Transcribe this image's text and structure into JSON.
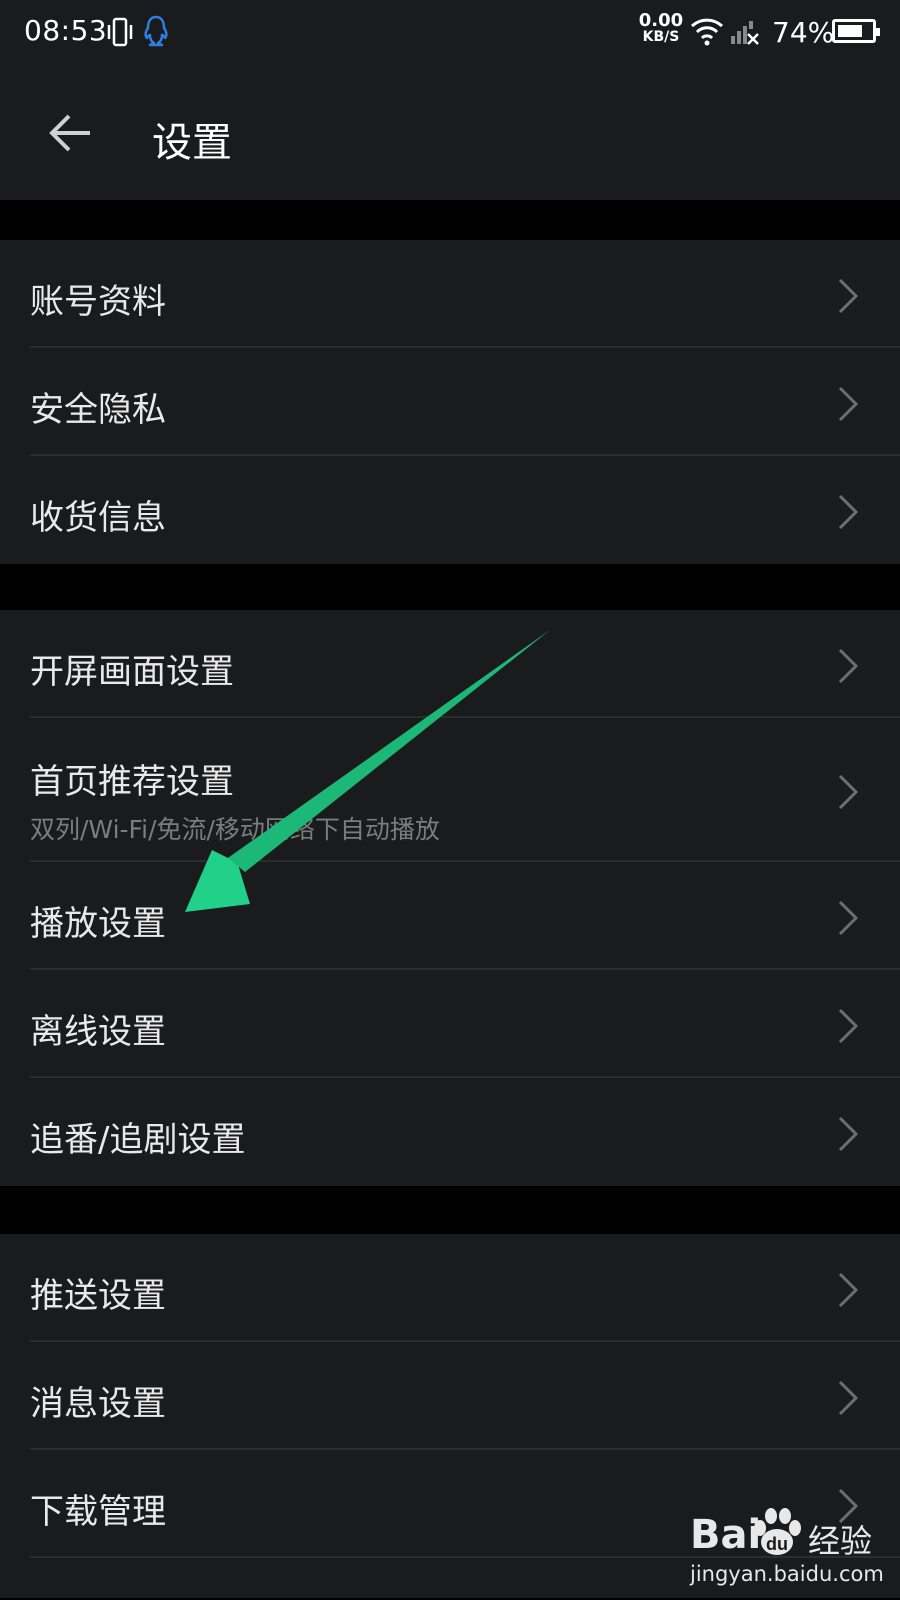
{
  "status_bar": {
    "time": "08:53",
    "speed_value": "0.00",
    "speed_unit": "KB/S",
    "battery_percent": "74%",
    "battery_level": 0.74,
    "icons": [
      "vibrate-icon",
      "qq-icon",
      "wifi-icon",
      "no-signal-icon",
      "battery-icon"
    ]
  },
  "header": {
    "title": "设置",
    "back_icon": "back-arrow-icon"
  },
  "groups": [
    {
      "items": [
        {
          "label": "账号资料"
        },
        {
          "label": "安全隐私"
        },
        {
          "label": "收货信息"
        }
      ]
    },
    {
      "items": [
        {
          "label": "开屏画面设置"
        },
        {
          "label": "首页推荐设置",
          "subtitle": "双列/Wi-Fi/免流/移动网络下自动播放"
        },
        {
          "label": "播放设置"
        },
        {
          "label": "离线设置"
        },
        {
          "label": "追番/追剧设置"
        }
      ]
    },
    {
      "items": [
        {
          "label": "推送设置"
        },
        {
          "label": "消息设置"
        },
        {
          "label": "下载管理"
        }
      ]
    }
  ],
  "colors": {
    "background": "#000000",
    "panel": "#1a1b1d",
    "divider": "#2b2c2f",
    "annotation_arrow": "#21d18a",
    "qq_icon": "#2c7fe0"
  },
  "watermark": {
    "brand": "Bai",
    "brand_cn": "经验",
    "url": "jingyan.baidu.com"
  }
}
